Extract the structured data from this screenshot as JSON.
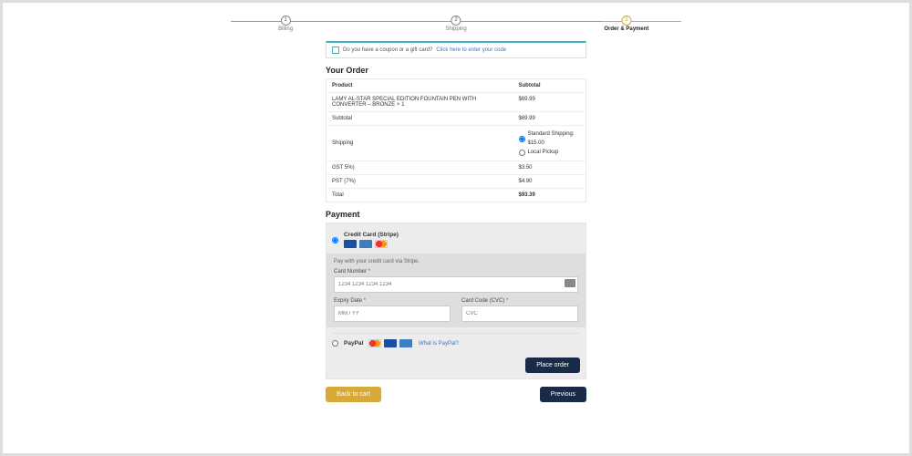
{
  "steps": {
    "s1": "Billing",
    "s2": "Shipping",
    "s3": "Order & Payment"
  },
  "coupon": {
    "text": "Do you have a coupon or a gift card?",
    "link": "Click here to enter your code"
  },
  "order": {
    "heading": "Your Order",
    "col_product": "Product",
    "col_subtotal": "Subtotal",
    "item_name": "LAMY AL-STAR SPECIAL EDITION FOUNTAIN PEN WITH CONVERTER – BRONZE  × 1",
    "item_price": "$69.99",
    "row_subtotal_label": "Subtotal",
    "row_subtotal_value": "$69.99",
    "row_shipping_label": "Shipping",
    "ship_standard": "Standard Shipping: $15.00",
    "ship_local": "Local Pickup",
    "row_gst_label": "GST 5%)",
    "row_gst_value": "$3.50",
    "row_pst_label": "PST (7%)",
    "row_pst_value": "$4.90",
    "row_total_label": "Total",
    "row_total_value": "$93.39"
  },
  "payment": {
    "heading": "Payment",
    "stripe_label": "Credit Card (Stripe)",
    "stripe_hint": "Pay with your credit card via Stripe.",
    "card_number_label": "Card Number",
    "card_number_placeholder": "1234 1234 1234 1234",
    "expiry_label": "Expiry Date",
    "expiry_placeholder": "MM / YY",
    "cvc_label": "Card Code (CVC)",
    "cvc_placeholder": "CVC",
    "paypal_label": "PayPal",
    "paypal_link": "What is PayPal?",
    "req": "*"
  },
  "buttons": {
    "place_order": "Place order",
    "back_to_cart": "Back to cart",
    "previous": "Previous"
  }
}
